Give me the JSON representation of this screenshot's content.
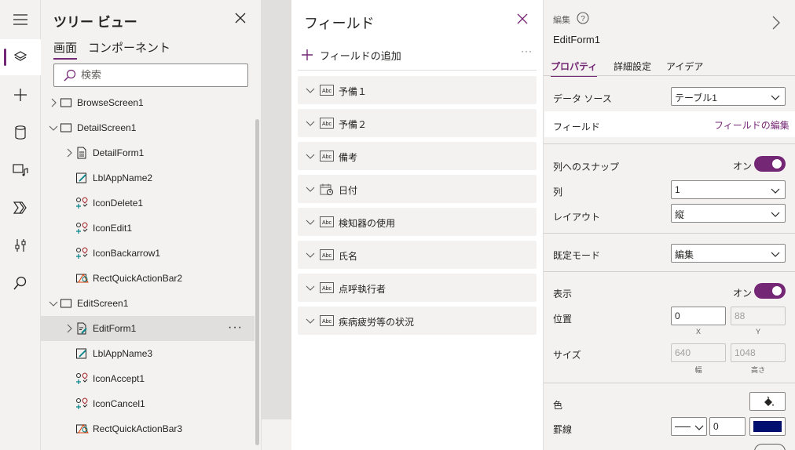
{
  "tree": {
    "title": "ツリー ビュー",
    "tabs": [
      "画面",
      "コンポーネント"
    ],
    "search_placeholder": "検索",
    "items": [
      {
        "label": "BrowseScreen1",
        "type": "screen",
        "level": 0,
        "expander": "collapsed",
        "selected": false
      },
      {
        "label": "DetailScreen1",
        "type": "screen",
        "level": 0,
        "expander": "expanded",
        "selected": false
      },
      {
        "label": "DetailForm1",
        "type": "form",
        "level": 1,
        "expander": "collapsed",
        "selected": false
      },
      {
        "label": "LblAppName2",
        "type": "label",
        "level": 1,
        "expander": "none",
        "selected": false
      },
      {
        "label": "IconDelete1",
        "type": "icon",
        "level": 1,
        "expander": "none",
        "selected": false
      },
      {
        "label": "IconEdit1",
        "type": "icon",
        "level": 1,
        "expander": "none",
        "selected": false
      },
      {
        "label": "IconBackarrow1",
        "type": "icon",
        "level": 1,
        "expander": "none",
        "selected": false
      },
      {
        "label": "RectQuickActionBar2",
        "type": "shape",
        "level": 1,
        "expander": "none",
        "selected": false
      },
      {
        "label": "EditScreen1",
        "type": "screen",
        "level": 0,
        "expander": "expanded",
        "selected": false
      },
      {
        "label": "EditForm1",
        "type": "form-edit",
        "level": 1,
        "expander": "collapsed",
        "selected": true
      },
      {
        "label": "LblAppName3",
        "type": "label",
        "level": 1,
        "expander": "none",
        "selected": false
      },
      {
        "label": "IconAccept1",
        "type": "icon",
        "level": 1,
        "expander": "none",
        "selected": false
      },
      {
        "label": "IconCancel1",
        "type": "icon",
        "level": 1,
        "expander": "none",
        "selected": false
      },
      {
        "label": "RectQuickActionBar3",
        "type": "shape",
        "level": 1,
        "expander": "none",
        "selected": false
      }
    ],
    "selected_more": "···"
  },
  "fields": {
    "title": "フィールド",
    "add_label": "フィールドの追加",
    "more": "···",
    "items": [
      {
        "label": "予備１",
        "type_icon": "text-abc-icon"
      },
      {
        "label": "予備２",
        "type_icon": "text-abc-icon"
      },
      {
        "label": "備考",
        "type_icon": "text-abc-icon"
      },
      {
        "label": "日付",
        "type_icon": "calendar-icon"
      },
      {
        "label": "検知器の使用",
        "type_icon": "text-abc-icon"
      },
      {
        "label": "氏名",
        "type_icon": "text-abc-icon"
      },
      {
        "label": "点呼執行者",
        "type_icon": "text-abc-icon"
      },
      {
        "label": "疾病疲労等の状況",
        "type_icon": "text-abc-icon"
      }
    ]
  },
  "props": {
    "kind": "編集",
    "name": "EditForm1",
    "tabs": [
      "プロパティ",
      "詳細設定",
      "アイデア"
    ],
    "datasource_label": "データ ソース",
    "datasource_value": "テーブル1",
    "fields_label": "フィールド",
    "fields_link": "フィールドの編集",
    "snap_label": "列へのスナップ",
    "snap_value": "オン",
    "columns_label": "列",
    "columns_value": "1",
    "layout_label": "レイアウト",
    "layout_value": "縦",
    "mode_label": "既定モード",
    "mode_value": "編集",
    "visible_label": "表示",
    "visible_value": "オン",
    "position_label": "位置",
    "x_value": "0",
    "y_value": "88",
    "x_caption": "X",
    "y_caption": "Y",
    "size_label": "サイズ",
    "width_value": "640",
    "height_value": "1048",
    "width_caption": "幅",
    "height_caption": "高さ",
    "color_label": "色",
    "border_label": "罫線",
    "border_width_value": "0",
    "accent_color": "#742774",
    "border_color": "#000f6e"
  }
}
